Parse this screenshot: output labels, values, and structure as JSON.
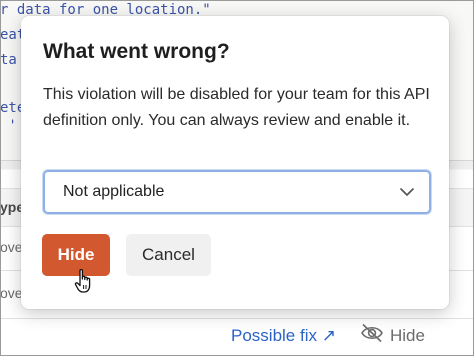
{
  "background": {
    "code_lines": [
      "r data for one location.\"",
      "eat",
      "ta",
      "",
      "ete",
      " '"
    ],
    "table": {
      "header": "ype",
      "rows": [
        "ove",
        "ove"
      ]
    },
    "footer": {
      "possible_fix": "Possible fix",
      "possible_fix_icon": "arrow-up-right-icon",
      "hide_label": "Hide",
      "hide_icon": "eye-slash-icon"
    }
  },
  "dialog": {
    "title": "What went wrong?",
    "description": "This violation will be disabled for your team for this API definition only. You can always review and enable it.",
    "select": {
      "value": "Not applicable",
      "icon": "chevron-down-icon"
    },
    "buttons": {
      "hide": "Hide",
      "cancel": "Cancel"
    },
    "colors": {
      "primary_button": "#d1582f",
      "focus_ring": "#8eb0e4",
      "link": "#2b63c6"
    }
  },
  "cursor": {
    "icon": "hand-pointer-icon"
  }
}
